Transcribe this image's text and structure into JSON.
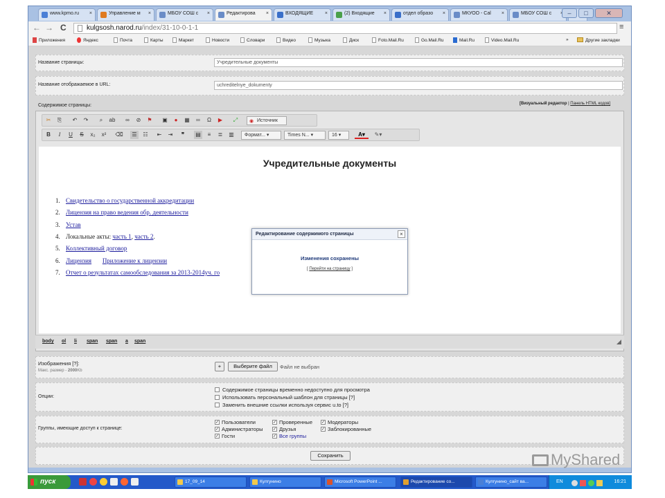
{
  "browser": {
    "tabs": [
      {
        "label": "www.kpmo.ru",
        "color": "#4a7fd6"
      },
      {
        "label": "Управление м",
        "color": "#e07a1f"
      },
      {
        "label": "МБОУ СОШ с",
        "color": "#6a8cc7"
      },
      {
        "label": "Редактирова",
        "color": "#6a8cc7"
      },
      {
        "label": "ВХОДЯЩИЕ",
        "color": "#3a6fc9"
      },
      {
        "label": "(2) Входящие",
        "color": "#4aa04a"
      },
      {
        "label": "отдел образо",
        "color": "#3a6fc9"
      },
      {
        "label": "МКУОО - Cal",
        "color": "#6a8cc7"
      },
      {
        "label": "МБОУ СОШ с",
        "color": "#6a8cc7"
      }
    ],
    "tab_close": "×",
    "url_host": "kulgsosh.narod.ru",
    "url_path": "/index/31-10-0-1-1",
    "star": "☆",
    "menu": "≡",
    "bookmarks": [
      "Приложения",
      "Яндекс",
      "Почта",
      "Карты",
      "Маркет",
      "Новости",
      "Словари",
      "Видео",
      "Музыка",
      "Диск",
      "Foto.Mail.Ru",
      "Go.Mail.Ru",
      "Mail.Ru",
      "Video.Mail.Ru"
    ],
    "more_bookmarks": "»",
    "other_bookmarks": "Другие закладки"
  },
  "form": {
    "page_name_label": "Название страницы:",
    "page_name_value": "Учредительные документы",
    "url_label": "Название отображаемое в URL:",
    "url_value": "uchreditelnye_dokumenty",
    "content_label": "Содержимое страницы:",
    "editor_mode_visual": "[Визуальный редактор",
    "editor_mode_html": "Панель HTML кодов]",
    "editor_mode_sep": "|"
  },
  "editor": {
    "source_button": "Источник",
    "format_select": "Формат...",
    "font_select": "Times N...",
    "size_select": "16",
    "heading": "Учредительные документы",
    "list": [
      {
        "n": "1.",
        "parts": [
          {
            "t": "Свидетельство о государственной аккредитации",
            "link": true
          }
        ]
      },
      {
        "n": "2.",
        "parts": [
          {
            "t": "Лицензия на право ведения обр. деятельности",
            "link": true
          }
        ]
      },
      {
        "n": "3.",
        "parts": [
          {
            "t": "Устав",
            "link": true
          }
        ]
      },
      {
        "n": "4.",
        "parts": [
          {
            "t": "Локальные акты: ",
            "link": false
          },
          {
            "t": "часть 1",
            "link": true
          },
          {
            "t": ", ",
            "link": false
          },
          {
            "t": "часть 2",
            "link": true
          },
          {
            "t": ".",
            "link": false
          }
        ]
      },
      {
        "n": "5.",
        "parts": [
          {
            "t": "Коллективный договор",
            "link": true
          }
        ]
      },
      {
        "n": "6.",
        "parts": [
          {
            "t": "Лицензия",
            "link": true
          },
          {
            "t": "       ",
            "link": false
          },
          {
            "t": "Приложение к лицензии",
            "link": true
          }
        ]
      },
      {
        "n": "7.",
        "parts": [
          {
            "t": "Отчет о результатах ",
            "link": true
          },
          {
            "t": "самообследования",
            "link": true
          },
          {
            "t": " за 2013-",
            "link": true
          },
          {
            "t": "2014уч",
            "link": true
          },
          {
            "t": ". го",
            "link": true
          }
        ]
      }
    ],
    "path": [
      "body",
      "ol",
      "li",
      "span",
      "span",
      "a",
      "span"
    ]
  },
  "upload": {
    "label": "Изображения [?]:",
    "sub_label": "Макс. размер - ",
    "sub_value": "2000",
    "sub_unit": "Kb",
    "plus": "+",
    "choose_button": "Выберите файл",
    "no_file": "Файл не выбран"
  },
  "options": {
    "label": "Опции:",
    "items": [
      "Содержимое страницы временно недоступно для просмотра",
      "Использовать персональный шаблон для страницы [?]",
      "Заменить внешние ссылки используя сервис u.to [?]"
    ]
  },
  "groups": {
    "label": "Группы, имеющие доступ к странице:",
    "items": [
      {
        "t": "Пользователи",
        "checked": true
      },
      {
        "t": "Проверенные",
        "checked": true
      },
      {
        "t": "Модераторы",
        "checked": true
      },
      {
        "t": "Администраторы",
        "checked": true
      },
      {
        "t": "Друзья",
        "checked": true
      },
      {
        "t": "Заблокированные",
        "checked": true
      },
      {
        "t": "Гости",
        "checked": true
      },
      {
        "t": "Все группы",
        "checked": true
      }
    ]
  },
  "save_button": "Сохранить",
  "dialog": {
    "title": "Редактирование содержимого страницы",
    "close": "×",
    "message": "Изменения сохранены",
    "link_open": "[ ",
    "link": "Перейти на страницу",
    "link_close": " ]"
  },
  "taskbar": {
    "start": "пуск",
    "tasks": [
      {
        "label": "17_09_14",
        "color": "#f2c94c"
      },
      {
        "label": "Кулгунино",
        "color": "#f2c94c"
      },
      {
        "label": "Microsoft PowerPoint ...",
        "color": "#d9532c"
      },
      {
        "label": "Редактирование со...",
        "color": "#e0a030"
      },
      {
        "label": "Кулгунино_сайт ва...",
        "color": "#4a7fd6"
      }
    ],
    "lang": "EN",
    "time": "16:21"
  },
  "watermark": "MyShared"
}
